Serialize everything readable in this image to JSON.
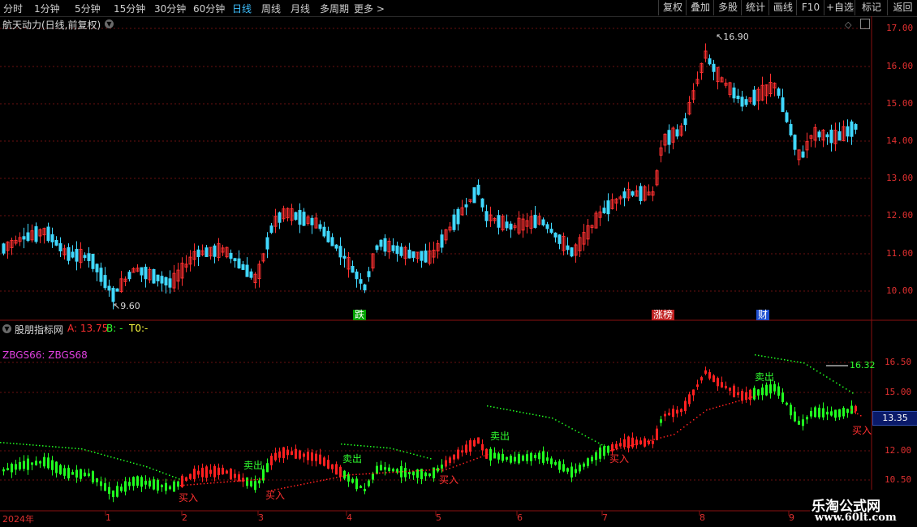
{
  "toolbar": {
    "periods": [
      "分时",
      "1分钟",
      "5分钟",
      "15分钟",
      "30分钟",
      "60分钟",
      "日线",
      "周线",
      "月线",
      "多周期",
      "更多 >"
    ],
    "active_period": "日线",
    "right_buttons": [
      "复权",
      "叠加",
      "多股",
      "统计",
      "画线",
      "F10",
      "+自选",
      "返回"
    ]
  },
  "main_panel": {
    "title": "航天动力(日线,前复权)",
    "price_ticks": [
      "17.00",
      "16.00",
      "15.00",
      "14.00",
      "13.00",
      "12.00",
      "11.00",
      "10.00"
    ],
    "high_label": "16.90",
    "low_label": "9.60",
    "tags": [
      {
        "text": "跌",
        "color": "#00c000"
      },
      {
        "text": "涨榜",
        "color": "#d02020"
      },
      {
        "text": "财",
        "color": "#2060e0"
      }
    ]
  },
  "indicator_panel": {
    "name": "股朋指标网",
    "a_label": "A:",
    "a_value": "13.75",
    "b_label": "B:",
    "b_value": "-",
    "t0_label": "T0:",
    "t0_value": "-",
    "formula_label": "ZBGS66: ZBGS68",
    "level_label": "16.32",
    "current_value": "13.35",
    "ticks": [
      "16.50",
      "15.00",
      "12.00",
      "10.50"
    ],
    "buy_signal": "买入",
    "sell_signal": "卖出"
  },
  "date_axis": {
    "year": "2024年",
    "months": [
      "1",
      "2",
      "3",
      "4",
      "5",
      "6",
      "7",
      "8",
      "9"
    ]
  },
  "watermark": {
    "line1": "乐淘公式网",
    "line2": "www.60lt.com"
  },
  "colors": {
    "up": "#ff3030",
    "down": "#40d8ff",
    "ind_up": "#ff2020",
    "ind_down": "#20ff20",
    "active": "#3ec0ff"
  }
}
